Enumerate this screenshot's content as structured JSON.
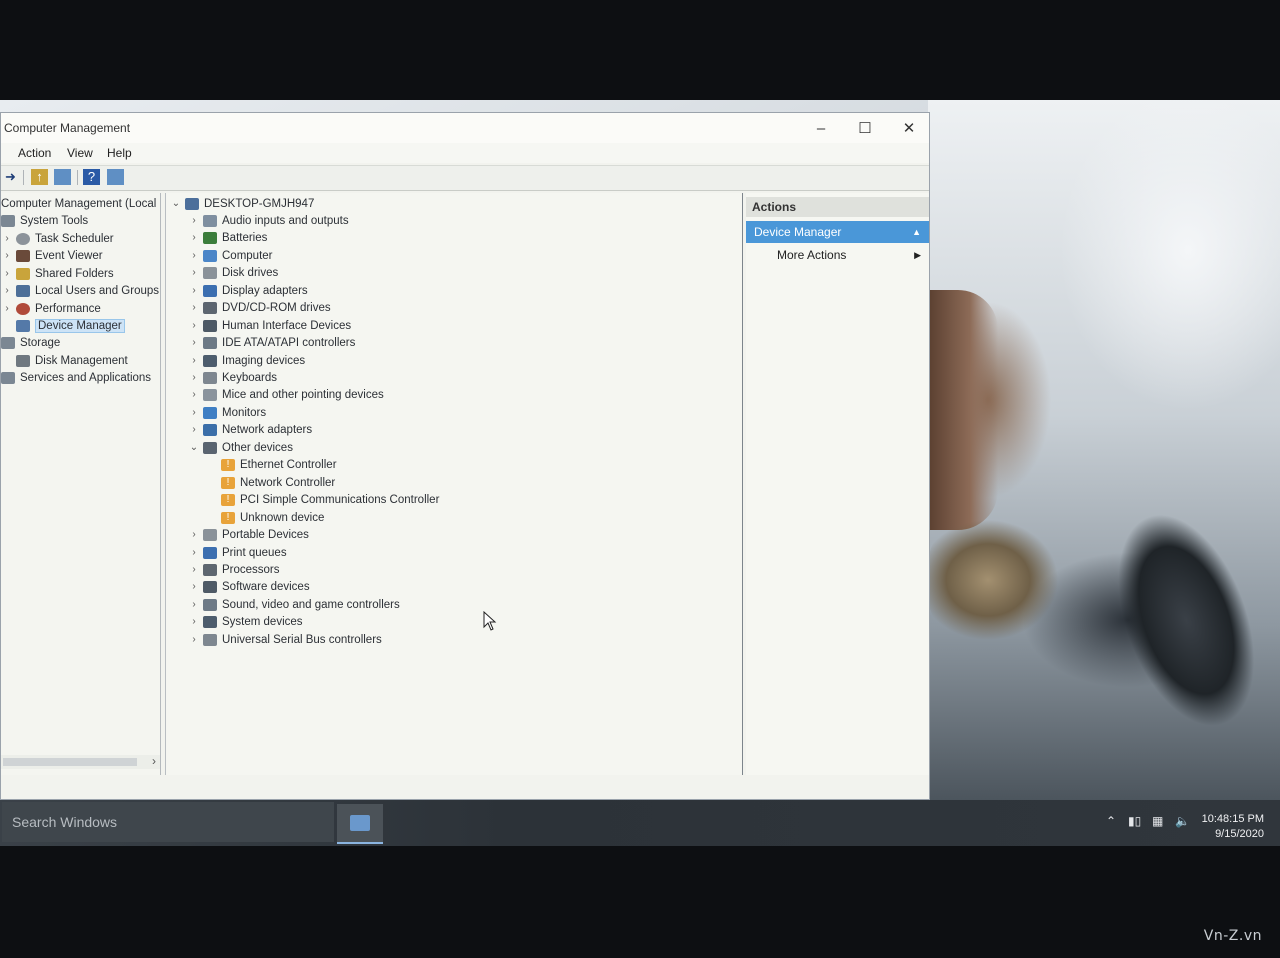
{
  "window": {
    "title": "Computer Management",
    "minimize_icon": "minimize-icon",
    "maximize_icon": "maximize-icon",
    "close_icon": "close-icon"
  },
  "menu": [
    "Action",
    "View",
    "Help"
  ],
  "toolbar": [
    "forward-icon",
    "up-folder-icon",
    "show-hide-console-tree-icon",
    "help-icon",
    "properties-icon"
  ],
  "tree": {
    "root": "Computer Management (Local",
    "system_tools": "System Tools",
    "items": [
      "Task Scheduler",
      "Event Viewer",
      "Shared Folders",
      "Local Users and Groups",
      "Performance",
      "Device Manager"
    ],
    "storage": "Storage",
    "disk_management": "Disk Management",
    "services": "Services and Applications"
  },
  "devices": {
    "computer_name": "DESKTOP-GMJH947",
    "categories": [
      "Audio inputs and outputs",
      "Batteries",
      "Computer",
      "Disk drives",
      "Display adapters",
      "DVD/CD-ROM drives",
      "Human Interface Devices",
      "IDE ATA/ATAPI controllers",
      "Imaging devices",
      "Keyboards",
      "Mice and other pointing devices",
      "Monitors",
      "Network adapters",
      "Other devices"
    ],
    "other_devices": [
      "Ethernet Controller",
      "Network Controller",
      "PCI Simple Communications Controller",
      "Unknown device"
    ],
    "categories_after": [
      "Portable Devices",
      "Print queues",
      "Processors",
      "Software devices",
      "Sound, video and game controllers",
      "System devices",
      "Universal Serial Bus controllers"
    ]
  },
  "actions": {
    "header": "Actions",
    "selected": "Device Manager",
    "more": "More Actions"
  },
  "taskbar": {
    "search_placeholder": "Search Windows",
    "time": "10:48:15 PM",
    "date": "9/15/2020"
  },
  "watermark": "Vn-Z.vn",
  "colors": {
    "selection": "#4a97d8",
    "warning": "#e8a33a"
  }
}
